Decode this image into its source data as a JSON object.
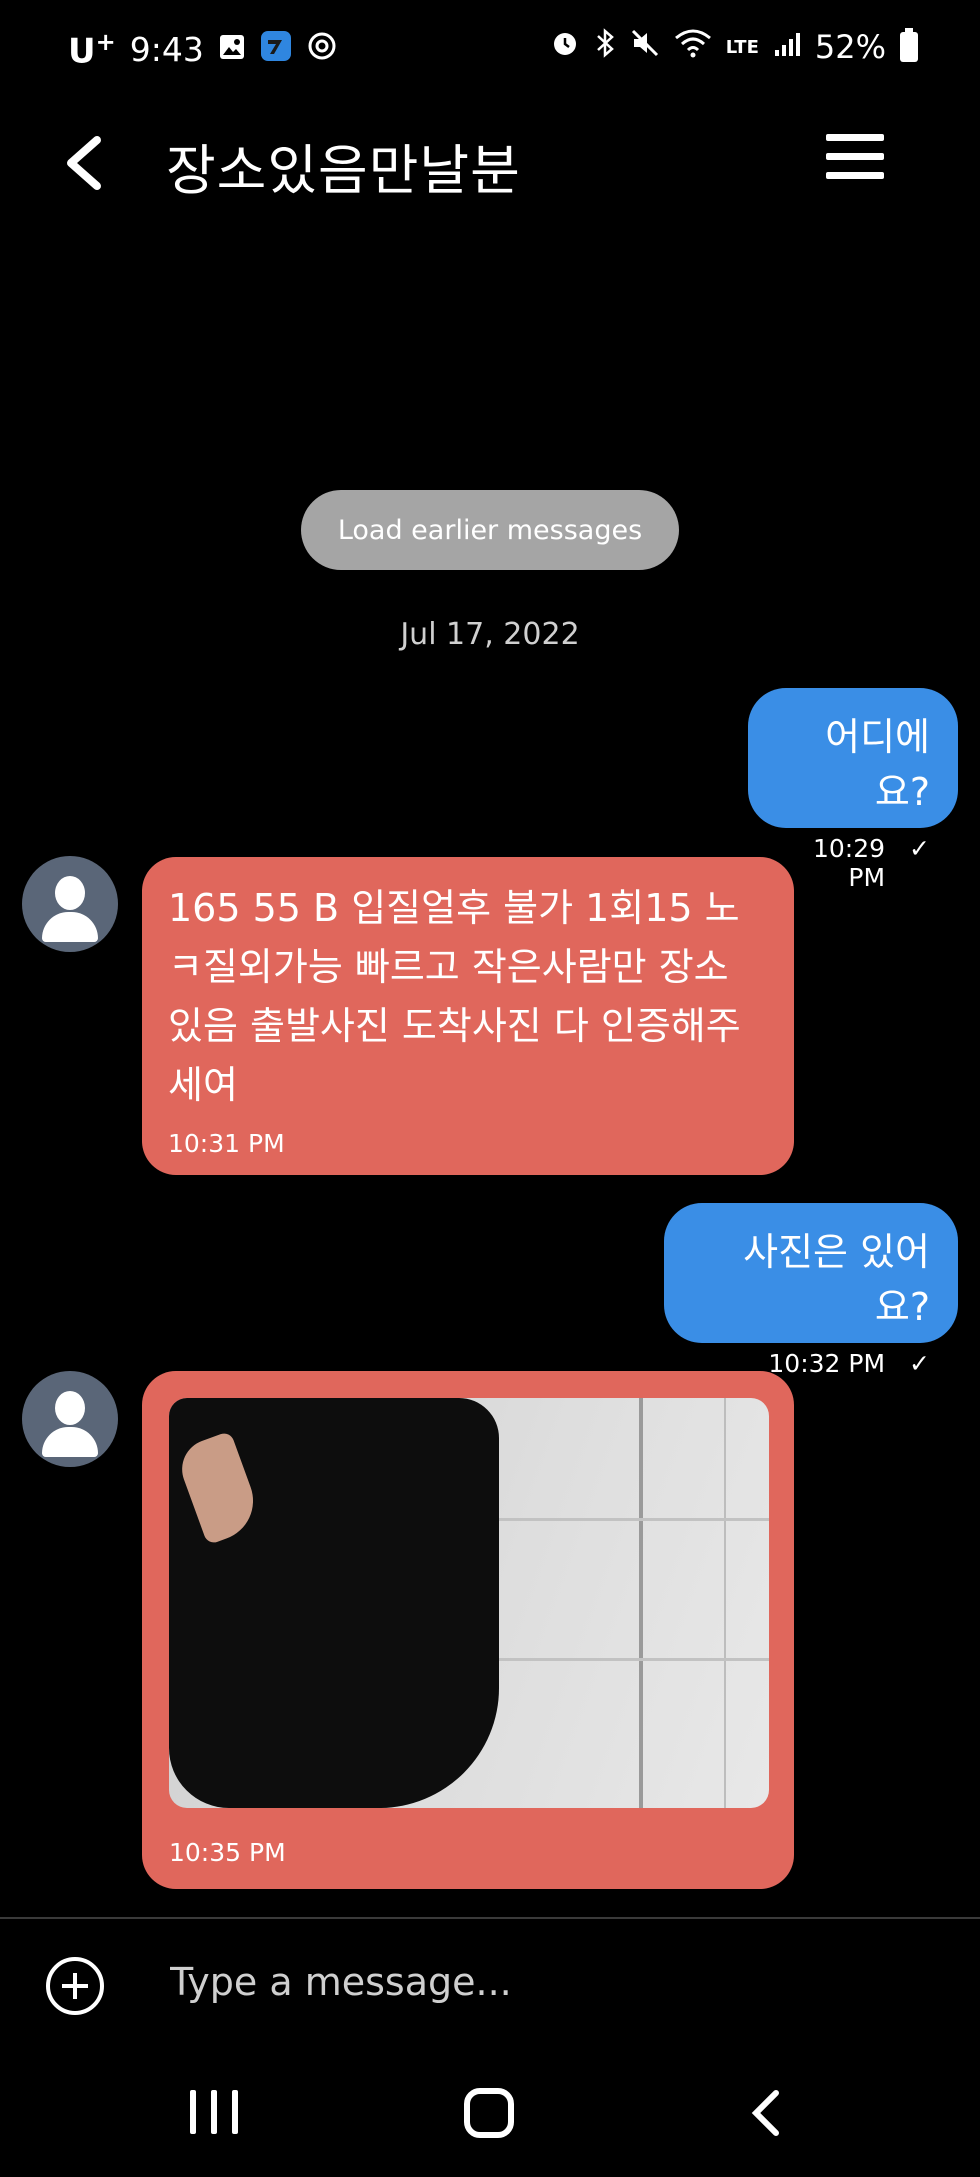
{
  "status_bar": {
    "carrier": "U",
    "carrier_sup": "+",
    "time": "9:43",
    "network": "LTE",
    "battery": "52%",
    "icons": [
      "gallery-icon",
      "app-icon",
      "settings-icon",
      "alarm-icon",
      "bluetooth-icon",
      "mute-icon",
      "wifi-icon",
      "signal-icon",
      "battery-icon"
    ]
  },
  "header": {
    "title": "장소있음만날분"
  },
  "chat": {
    "load_earlier": "Load earlier messages",
    "date": "Jul 17, 2022",
    "messages": [
      {
        "direction": "out",
        "text": "어디에요?",
        "time": "10:29 PM",
        "status": "✓"
      },
      {
        "direction": "in",
        "text": "165 55 B 입질얼후 불가 1회15 노ㅋ질외가능 빠르고 작은사람만 장소 있음 출발사진 도착사진 다 인증해주세여",
        "time": "10:31 PM"
      },
      {
        "direction": "out",
        "text": "사진은 있어요?",
        "time": "10:32 PM",
        "status": "✓"
      },
      {
        "direction": "in",
        "type": "photo",
        "time": "10:35 PM"
      }
    ],
    "colors": {
      "outgoing": "#3a8ee6",
      "incoming": "#e0675c"
    }
  },
  "composer": {
    "placeholder": "Type a message..."
  }
}
